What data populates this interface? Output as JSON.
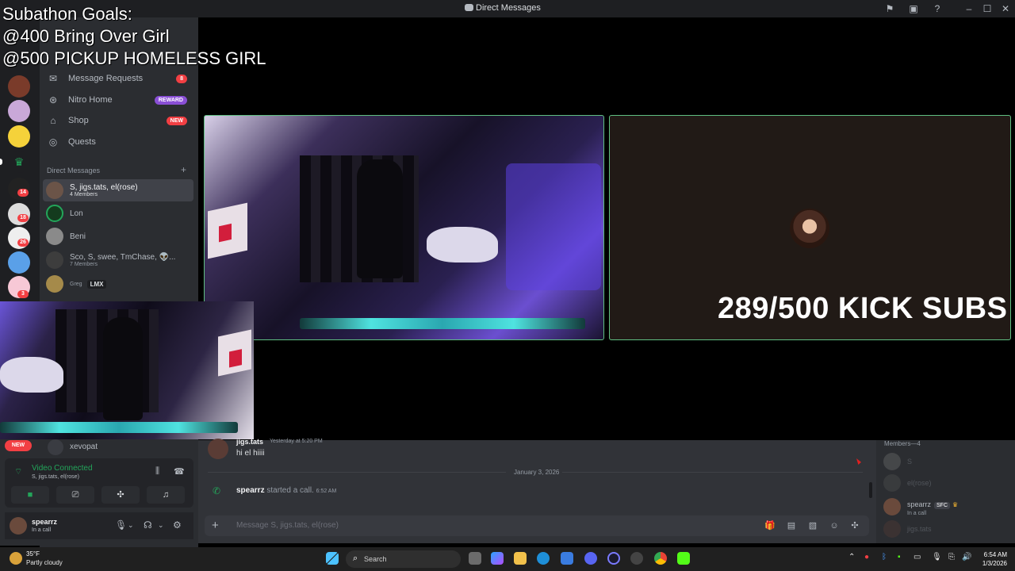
{
  "window": {
    "title": "Direct Messages"
  },
  "overlay": {
    "goals_title": "Subathon Goals:",
    "goal_1": "@400 Bring Over Girl",
    "goal_2": "@500 PICKUP HOMELESS GIRL",
    "sub_counter": "289/500 KICK SUBS"
  },
  "servers": {
    "badges": [
      "14",
      "18",
      "26",
      "3"
    ]
  },
  "nav": {
    "message_requests": "Message Requests",
    "message_requests_count": "8",
    "nitro_home": "Nitro Home",
    "nitro_badge": "REWARD",
    "shop": "Shop",
    "shop_badge": "NEW",
    "quests": "Quests"
  },
  "dm_section": {
    "header": "Direct Messages",
    "add": "+"
  },
  "dms": [
    {
      "name": "S, jigs.tats, el(rose)",
      "sub": "4 Members"
    },
    {
      "name": "Lon",
      "sub": ""
    },
    {
      "name": "Beni",
      "sub": ""
    },
    {
      "name": "Sco, S, swee, TmChase, 👽...",
      "sub": "7 Members"
    },
    {
      "name": "Greg",
      "sub": "",
      "tag": "LMX"
    }
  ],
  "below_overlay": {
    "new_pill": "NEW",
    "xevo_name": "xevopat"
  },
  "voice": {
    "status": "Video Connected",
    "channel": "S, jigs.tats, el(rose)"
  },
  "user": {
    "name": "spearrz",
    "status": "In a call"
  },
  "chat": {
    "author": "jigs.tats",
    "author_time": "Yesterday at 5:20 PM",
    "message": "hi el hiiii",
    "date_divider": "January 3, 2026",
    "call_user": "spearrz",
    "call_action": " started a call.",
    "call_time": "6:52 AM",
    "composer_placeholder": "Message S, jigs.tats, el(rose)"
  },
  "members": {
    "header": "Members—4",
    "list": [
      {
        "name": "S",
        "dim": true
      },
      {
        "name": "el(rose)",
        "dim": true
      },
      {
        "name": "spearrz",
        "tag": "SFC",
        "sub": "In a call"
      },
      {
        "name": "jigs.tats",
        "dim": true
      }
    ]
  },
  "taskbar": {
    "temp": "35°F",
    "weather": "Partly cloudy",
    "search": "Search",
    "time": "6:54 AM",
    "date": "1/3/2026"
  },
  "colors": {
    "online": "#23a55a",
    "danger": "#f23f43",
    "brand": "#5865f2",
    "tile_border": "#5fbf82"
  }
}
